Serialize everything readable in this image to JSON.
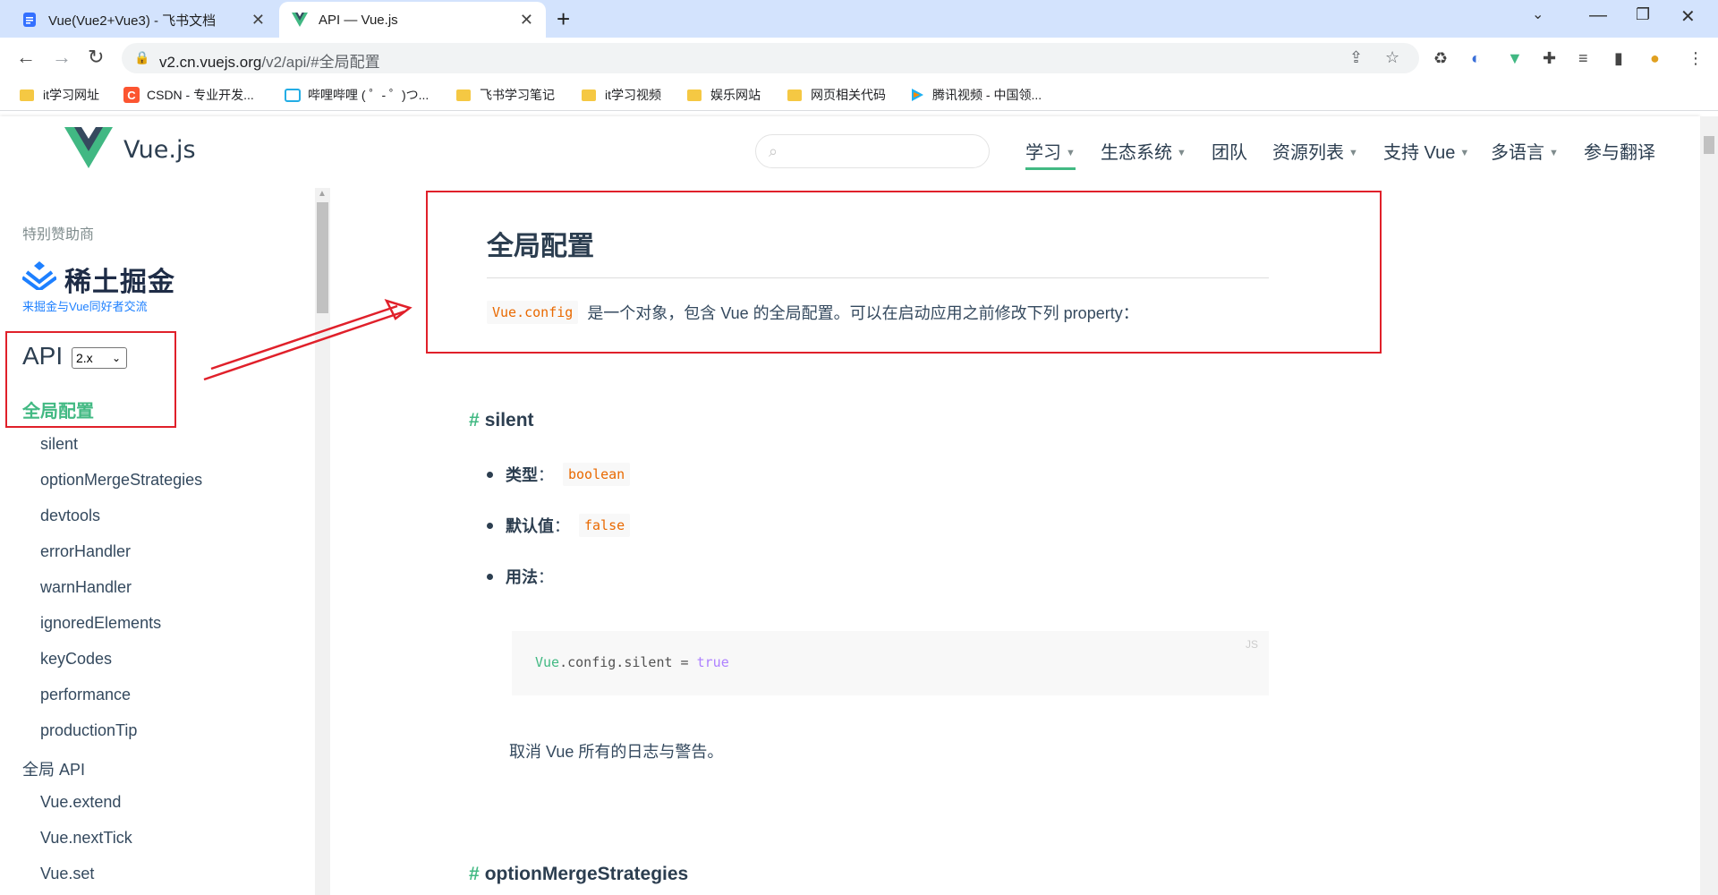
{
  "browser": {
    "tabs": [
      {
        "title": "Vue(Vue2+Vue3) - 飞书文档",
        "active": false,
        "icon": "feishu-doc-icon"
      },
      {
        "title": "API — Vue.js",
        "active": true,
        "icon": "vue-logo-icon"
      }
    ],
    "new_tab_label": "+",
    "url_host": "v2.cn.vuejs.org",
    "url_path": "/v2/api/#全局配置",
    "bookmarks": [
      {
        "label": "it学习网址",
        "icon": "folder-icon"
      },
      {
        "label": "CSDN - 专业开发...",
        "icon": "csdn-icon"
      },
      {
        "label": "哔哩哔哩 ( ゜- ゜)つ...",
        "icon": "bilibili-icon"
      },
      {
        "label": "飞书学习笔记",
        "icon": "folder-icon"
      },
      {
        "label": "it学习视频",
        "icon": "folder-icon"
      },
      {
        "label": "娱乐网站",
        "icon": "folder-icon"
      },
      {
        "label": "网页相关代码",
        "icon": "folder-icon"
      },
      {
        "label": "腾讯视频 - 中国领...",
        "icon": "tencent-video-icon"
      }
    ]
  },
  "header": {
    "brand": "Vue.js",
    "search_placeholder": "",
    "nav": [
      {
        "label": "学习",
        "dropdown": true,
        "current": true
      },
      {
        "label": "生态系统",
        "dropdown": true
      },
      {
        "label": "团队",
        "dropdown": false
      },
      {
        "label": "资源列表",
        "dropdown": true
      },
      {
        "label": "支持 Vue",
        "dropdown": true
      },
      {
        "label": "多语言",
        "dropdown": true
      },
      {
        "label": "参与翻译",
        "dropdown": false
      }
    ]
  },
  "sidebar": {
    "sponsor_label": "特别赞助商",
    "sponsor_name": "稀土掘金",
    "sponsor_tagline": "来掘金与Vue同好者交流",
    "api_title": "API",
    "version": "2.x",
    "active_section": "全局配置",
    "items": [
      "silent",
      "optionMergeStrategies",
      "devtools",
      "errorHandler",
      "warnHandler",
      "ignoredElements",
      "keyCodes",
      "performance",
      "productionTip"
    ],
    "next_section": "全局 API",
    "next_items": [
      "Vue.extend",
      "Vue.nextTick",
      "Vue.set"
    ]
  },
  "content": {
    "title": "全局配置",
    "intro_code": "Vue.config",
    "intro_text": "是一个对象，包含 Vue 的全局配置。可以在启动应用之前修改下列 property：",
    "section1": {
      "hash": "#",
      "title": "silent",
      "type_label": "类型",
      "type_value": "boolean",
      "default_label": "默认值",
      "default_value": "false",
      "usage_label": "用法",
      "colon": "：",
      "code_lang": "JS",
      "code_obj": "Vue",
      "code_rest": ".config.silent = ",
      "code_value": "true",
      "description": "取消 Vue 所有的日志与警告。"
    },
    "section2": {
      "hash": "#",
      "title": "optionMergeStrategies"
    }
  },
  "colors": {
    "accent": "#42b983",
    "annotation": "#e0202a",
    "text": "#2c3e50"
  }
}
